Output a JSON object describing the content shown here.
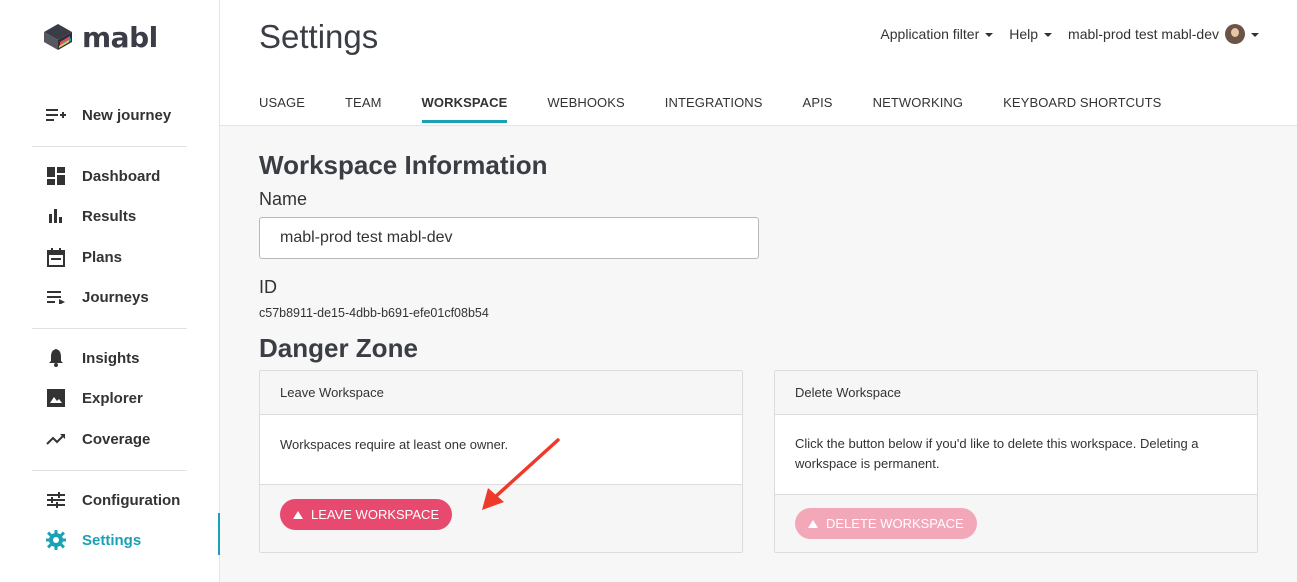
{
  "app": {
    "logo_text": "mabl"
  },
  "sidebar": {
    "items": [
      {
        "label": "New journey",
        "icon": "new-journey-icon"
      },
      {
        "label": "Dashboard",
        "icon": "dashboard-icon"
      },
      {
        "label": "Results",
        "icon": "bar-chart-icon"
      },
      {
        "label": "Plans",
        "icon": "calendar-icon"
      },
      {
        "label": "Journeys",
        "icon": "journeys-list-icon"
      },
      {
        "label": "Insights",
        "icon": "bell-icon"
      },
      {
        "label": "Explorer",
        "icon": "image-icon"
      },
      {
        "label": "Coverage",
        "icon": "trending-up-icon"
      },
      {
        "label": "Configuration",
        "icon": "sliders-icon"
      },
      {
        "label": "Settings",
        "icon": "gear-icon",
        "active": true
      }
    ]
  },
  "header": {
    "title": "Settings",
    "application_filter": "Application filter",
    "help": "Help",
    "workspace_name": "mabl-prod test mabl-dev"
  },
  "tabs": [
    {
      "label": "USAGE"
    },
    {
      "label": "TEAM"
    },
    {
      "label": "WORKSPACE",
      "active": true
    },
    {
      "label": "WEBHOOKS"
    },
    {
      "label": "INTEGRATIONS"
    },
    {
      "label": "APIS"
    },
    {
      "label": "NETWORKING"
    },
    {
      "label": "KEYBOARD SHORTCUTS"
    }
  ],
  "workspace": {
    "section_title": "Workspace Information",
    "name_label": "Name",
    "name_value": "mabl-prod test mabl-dev",
    "id_label": "ID",
    "id_value": "c57b8911-de15-4dbb-b691-efe01cf08b54"
  },
  "danger_zone": {
    "title": "Danger Zone",
    "leave": {
      "header": "Leave Workspace",
      "body": "Workspaces require at least one owner.",
      "button": "LEAVE WORKSPACE"
    },
    "delete": {
      "header": "Delete Workspace",
      "body": "Click the button below if you'd like to delete this workspace. Deleting a workspace is permanent.",
      "button": "DELETE WORKSPACE"
    }
  },
  "colors": {
    "accent": "#1aa1b5",
    "danger": "#e7496f",
    "danger_disabled": "#f3a8ba",
    "annotation_arrow": "#ee3a2a"
  }
}
